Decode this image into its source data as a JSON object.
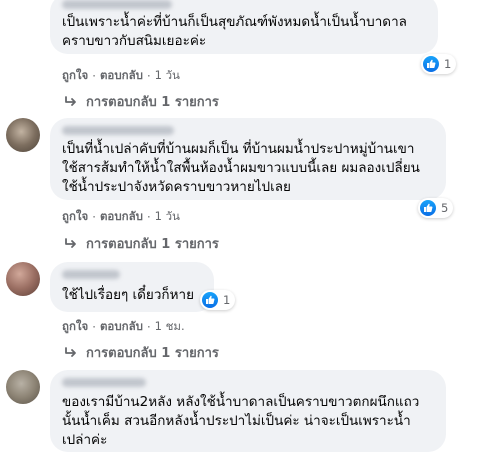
{
  "comments": [
    {
      "text": "เป็นเพราะน้ำค่ะที่บ้านก็เป็นสุขภัณฑ์พังหมดน้ำเป็นน้ำบาดาล\nคราบขาวกับสนิมเยอะค่ะ",
      "like": "ถูกใจ",
      "reply": "ตอบกลับ",
      "time": "1 วัน",
      "reactions": "1",
      "replies": "การตอบกลับ 1 รายการ"
    },
    {
      "text": "เป็นที่น้ำเปล่าคับที่บ้านผมก็เป็น ที่บ้านผมน้ำประปาหมู่บ้านเขา\nใช้สารส้มทำให้น้ำใสพื้นห้องน้ำผมขาวแบบนี้เลย ผมลองเปลี่ยน\nใช้น้ำประปาจังหวัดคราบขาวหายไปเลย",
      "like": "ถูกใจ",
      "reply": "ตอบกลับ",
      "time": "1 วัน",
      "reactions": "5",
      "replies": "การตอบกลับ 1 รายการ"
    },
    {
      "text": "ใช้ไปเรื่อยๆ เดี๋ยวก็หาย",
      "like": "ถูกใจ",
      "reply": "ตอบกลับ",
      "time": "1 ชม.",
      "reactions": "1",
      "replies": "การตอบกลับ 1 รายการ"
    },
    {
      "text": "ของเรามีบ้าน2หลัง หลังใช้น้ำบาดาลเป็นคราบขาวตกผนึกแถว\nนั้นน้ำเค็ม สวนอีกหลังน้ำประปาไม่เป็นค่ะ น่าจะเป็นเพราะน้ำ\nเปล่าค่ะ"
    }
  ],
  "icons": {
    "like": "like-thumb-icon",
    "reply_arrow": "reply-arrow-icon"
  },
  "colors": {
    "bubble": "#f0f2f5",
    "meta": "#65676b",
    "like_blue": "#1877f2"
  }
}
